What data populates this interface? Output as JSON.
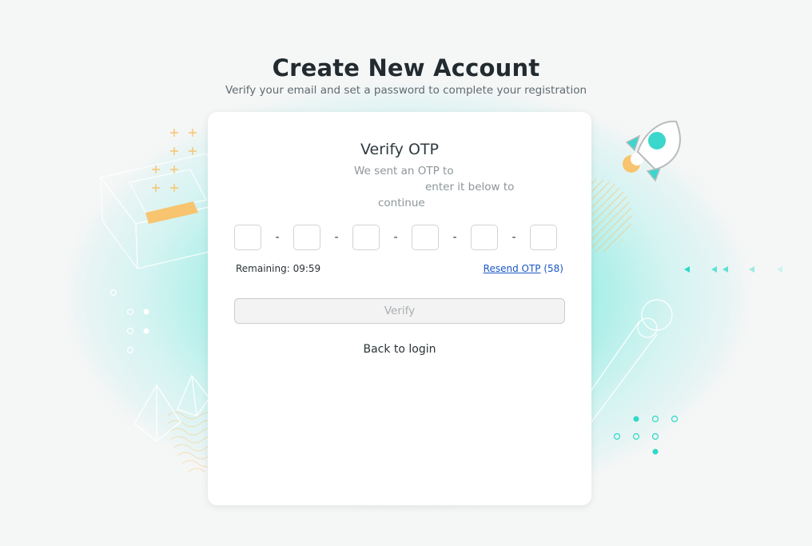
{
  "page": {
    "title": "Create New Account",
    "subtitle": "Verify your email and set a password to complete your registration"
  },
  "card": {
    "title": "Verify OTP",
    "message_line1": "We sent an OTP to",
    "message_line2": "enter it below to",
    "message_line3": "continue"
  },
  "otp": {
    "digits": [
      "",
      "",
      "",
      "",
      "",
      ""
    ],
    "separator": "-"
  },
  "timer": {
    "remaining_text": "Remaining: 09:59"
  },
  "resend": {
    "link_label": "Resend OTP",
    "countdown": "(58)"
  },
  "actions": {
    "verify_label": "Verify",
    "back_label": "Back to login"
  },
  "colors": {
    "accent": "#2fd8c8",
    "orange": "#f8c46f",
    "link": "#1a56c7"
  }
}
